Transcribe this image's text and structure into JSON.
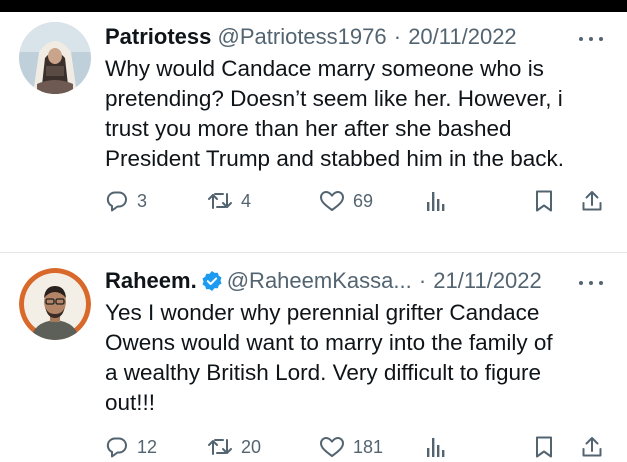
{
  "tweets": [
    {
      "name": "Patriotess",
      "handle": "@Patriotess1976",
      "separator": "·",
      "date": "20/11/2022",
      "verified": false,
      "text_lines": [
        "Why would Candace marry someone who is",
        "pretending? Doesn’t seem like her. However, i",
        "trust you more than her after she bashed",
        "President Trump and stabbed him in the back."
      ],
      "replies": "3",
      "retweets": "4",
      "likes": "69"
    },
    {
      "name": "Raheem.",
      "handle": "@RaheemKassa...",
      "separator": "·",
      "date": "21/11/2022",
      "verified": true,
      "text_lines": [
        "Yes I wonder why perennial grifter Candace",
        "Owens would want to marry into the family of",
        "a wealthy British Lord. Very difficult to figure",
        "out!!!"
      ],
      "replies": "12",
      "retweets": "20",
      "likes": "181"
    }
  ],
  "icons": {
    "reply": "reply-icon",
    "retweet": "retweet-icon",
    "like": "heart-icon",
    "views": "views-icon",
    "bookmark": "bookmark-icon",
    "share": "share-icon",
    "more": "more-icon",
    "verified": "verified-badge-icon"
  },
  "colors": {
    "text": "#0f1419",
    "secondary": "#536471",
    "verified": "#1d9bf0",
    "background": "#ffffff"
  }
}
